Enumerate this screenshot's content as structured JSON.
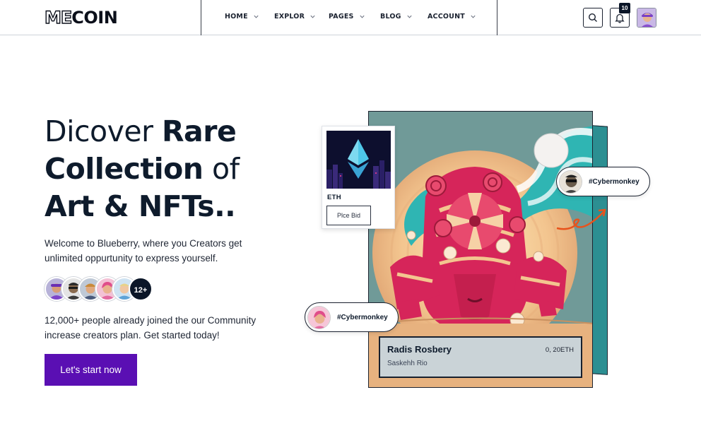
{
  "brand": {
    "logo_prefix": "ME",
    "logo_suffix": "COIN"
  },
  "nav": {
    "items": [
      {
        "label": "HOME"
      },
      {
        "label": "EXPLOR"
      },
      {
        "label": "PAGES"
      },
      {
        "label": "BLOG"
      },
      {
        "label": "ACCOUNT"
      }
    ]
  },
  "header_actions": {
    "search_icon": "search-icon",
    "notification_icon": "bell-icon",
    "notification_count": "10"
  },
  "hero": {
    "title_word1": "Dicover",
    "title_word2": "Rare",
    "title_word3": "Collection",
    "title_word4": "of",
    "title_word5": "Art & NFTs..",
    "description": "Welcome to Blueberry, where you Creators get unlimited oppurtunity to express yourself.",
    "avatar_count": "12+",
    "community_text": "12,000+ people already joined the our Community increase creators plan. Get started today!",
    "cta_label": "Let's start now"
  },
  "eth_card": {
    "label": "ETH",
    "button": "Plce Bid"
  },
  "tags": {
    "top": "#Cybermonkey",
    "bottom": "#Cybermonkey"
  },
  "artwork": {
    "title": "Radis Rosbery",
    "artist": "Saskehh Rio",
    "price": "0, 20ETH"
  },
  "colors": {
    "primary": "#5a0fb3",
    "dark": "#0b1628",
    "art_teal": "#2fb5b3",
    "art_pink": "#d6255a"
  }
}
